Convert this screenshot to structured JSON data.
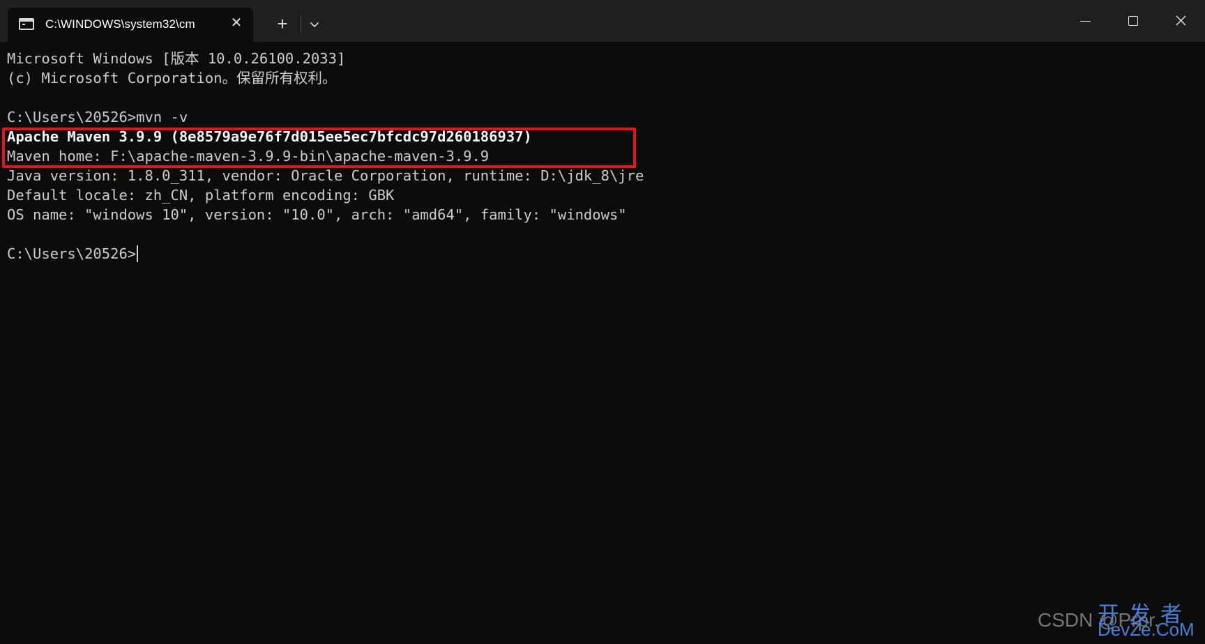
{
  "window": {
    "tab_title": "C:\\WINDOWS\\system32\\cm",
    "tab_close_glyph": "✕",
    "new_tab_glyph": "+"
  },
  "console": {
    "lines": [
      "Microsoft Windows [版本 10.0.26100.2033]",
      "(c) Microsoft Corporation。保留所有权利。",
      "",
      "C:\\Users\\20526>mvn -v",
      "Apache Maven 3.9.9 (8e8579a9e76f7d015ee5ec7bfcdc97d260186937)",
      "Maven home: F:\\apache-maven-3.9.9-bin\\apache-maven-3.9.9",
      "Java version: 1.8.0_311, vendor: Oracle Corporation, runtime: D:\\jdk_8\\jre",
      "Default locale: zh_CN, platform encoding: GBK",
      "OS name: \"windows 10\", version: \"10.0\", arch: \"amd64\", family: \"windows\"",
      "",
      "C:\\Users\\20526>"
    ]
  },
  "watermark": {
    "csdn": "CSDN @Prpr.",
    "cn": "开发者",
    "en": "DevZe.CoM"
  },
  "colors": {
    "console_bg": "#0c0c0c",
    "titlebar_bg": "#202020",
    "text": "#cccccc",
    "highlight": "#e3161c",
    "watermark": "#4a7fd6"
  }
}
